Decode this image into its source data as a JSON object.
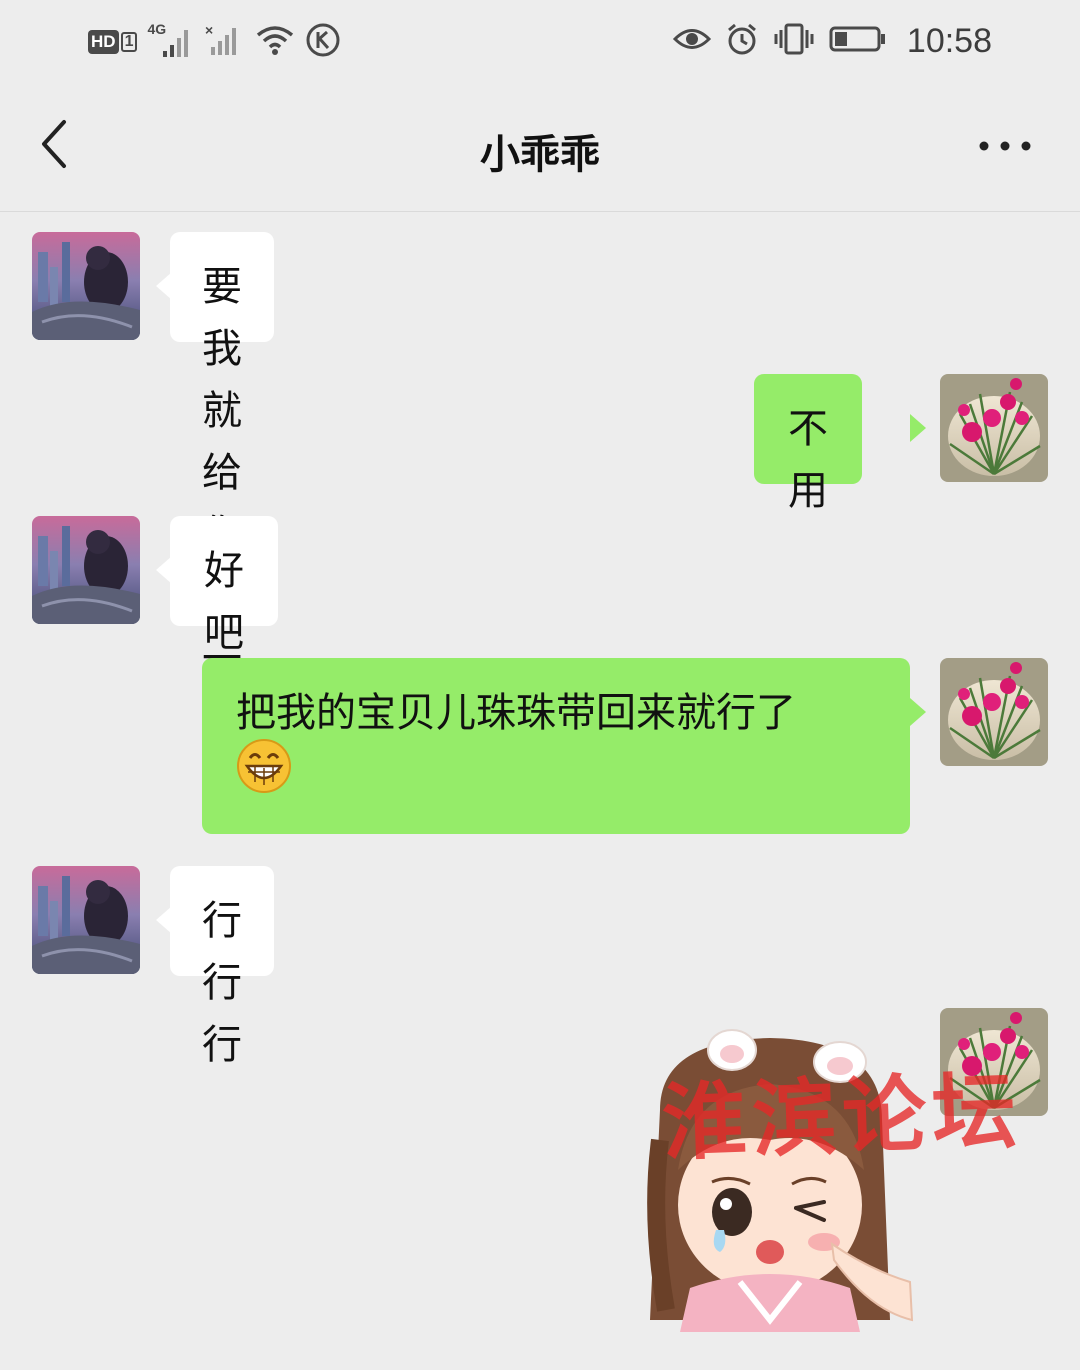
{
  "status_bar": {
    "network_badge": "HD",
    "network_badge_sub": "1",
    "signal_label": "4G",
    "time": "10:58",
    "icons": [
      "hd-icon",
      "signal-4g-icon",
      "signal-no-sim-icon",
      "wifi-icon",
      "k-app-icon",
      "eye-icon",
      "alarm-icon",
      "vibrate-icon",
      "battery-icon"
    ]
  },
  "header": {
    "title": "小乖乖",
    "back_icon": "chevron-left-icon",
    "more_icon": "more-dots-icon"
  },
  "messages": [
    {
      "side": "in",
      "text": "要我就给你带一杯"
    },
    {
      "side": "out",
      "text": "不用"
    },
    {
      "side": "in",
      "text": "好吧"
    },
    {
      "side": "out",
      "text": "把我的宝贝儿珠珠带回来就行了",
      "emoji": "grinning-face-icon"
    },
    {
      "side": "in",
      "text": "行行行"
    },
    {
      "side": "out",
      "type": "sticker",
      "sticker": "crying-girl-sticker"
    }
  ],
  "watermark": "淮滨论坛",
  "colors": {
    "background": "#ededed",
    "incoming_bubble": "#ffffff",
    "outgoing_bubble": "#95ec69",
    "watermark": "#e62828"
  }
}
